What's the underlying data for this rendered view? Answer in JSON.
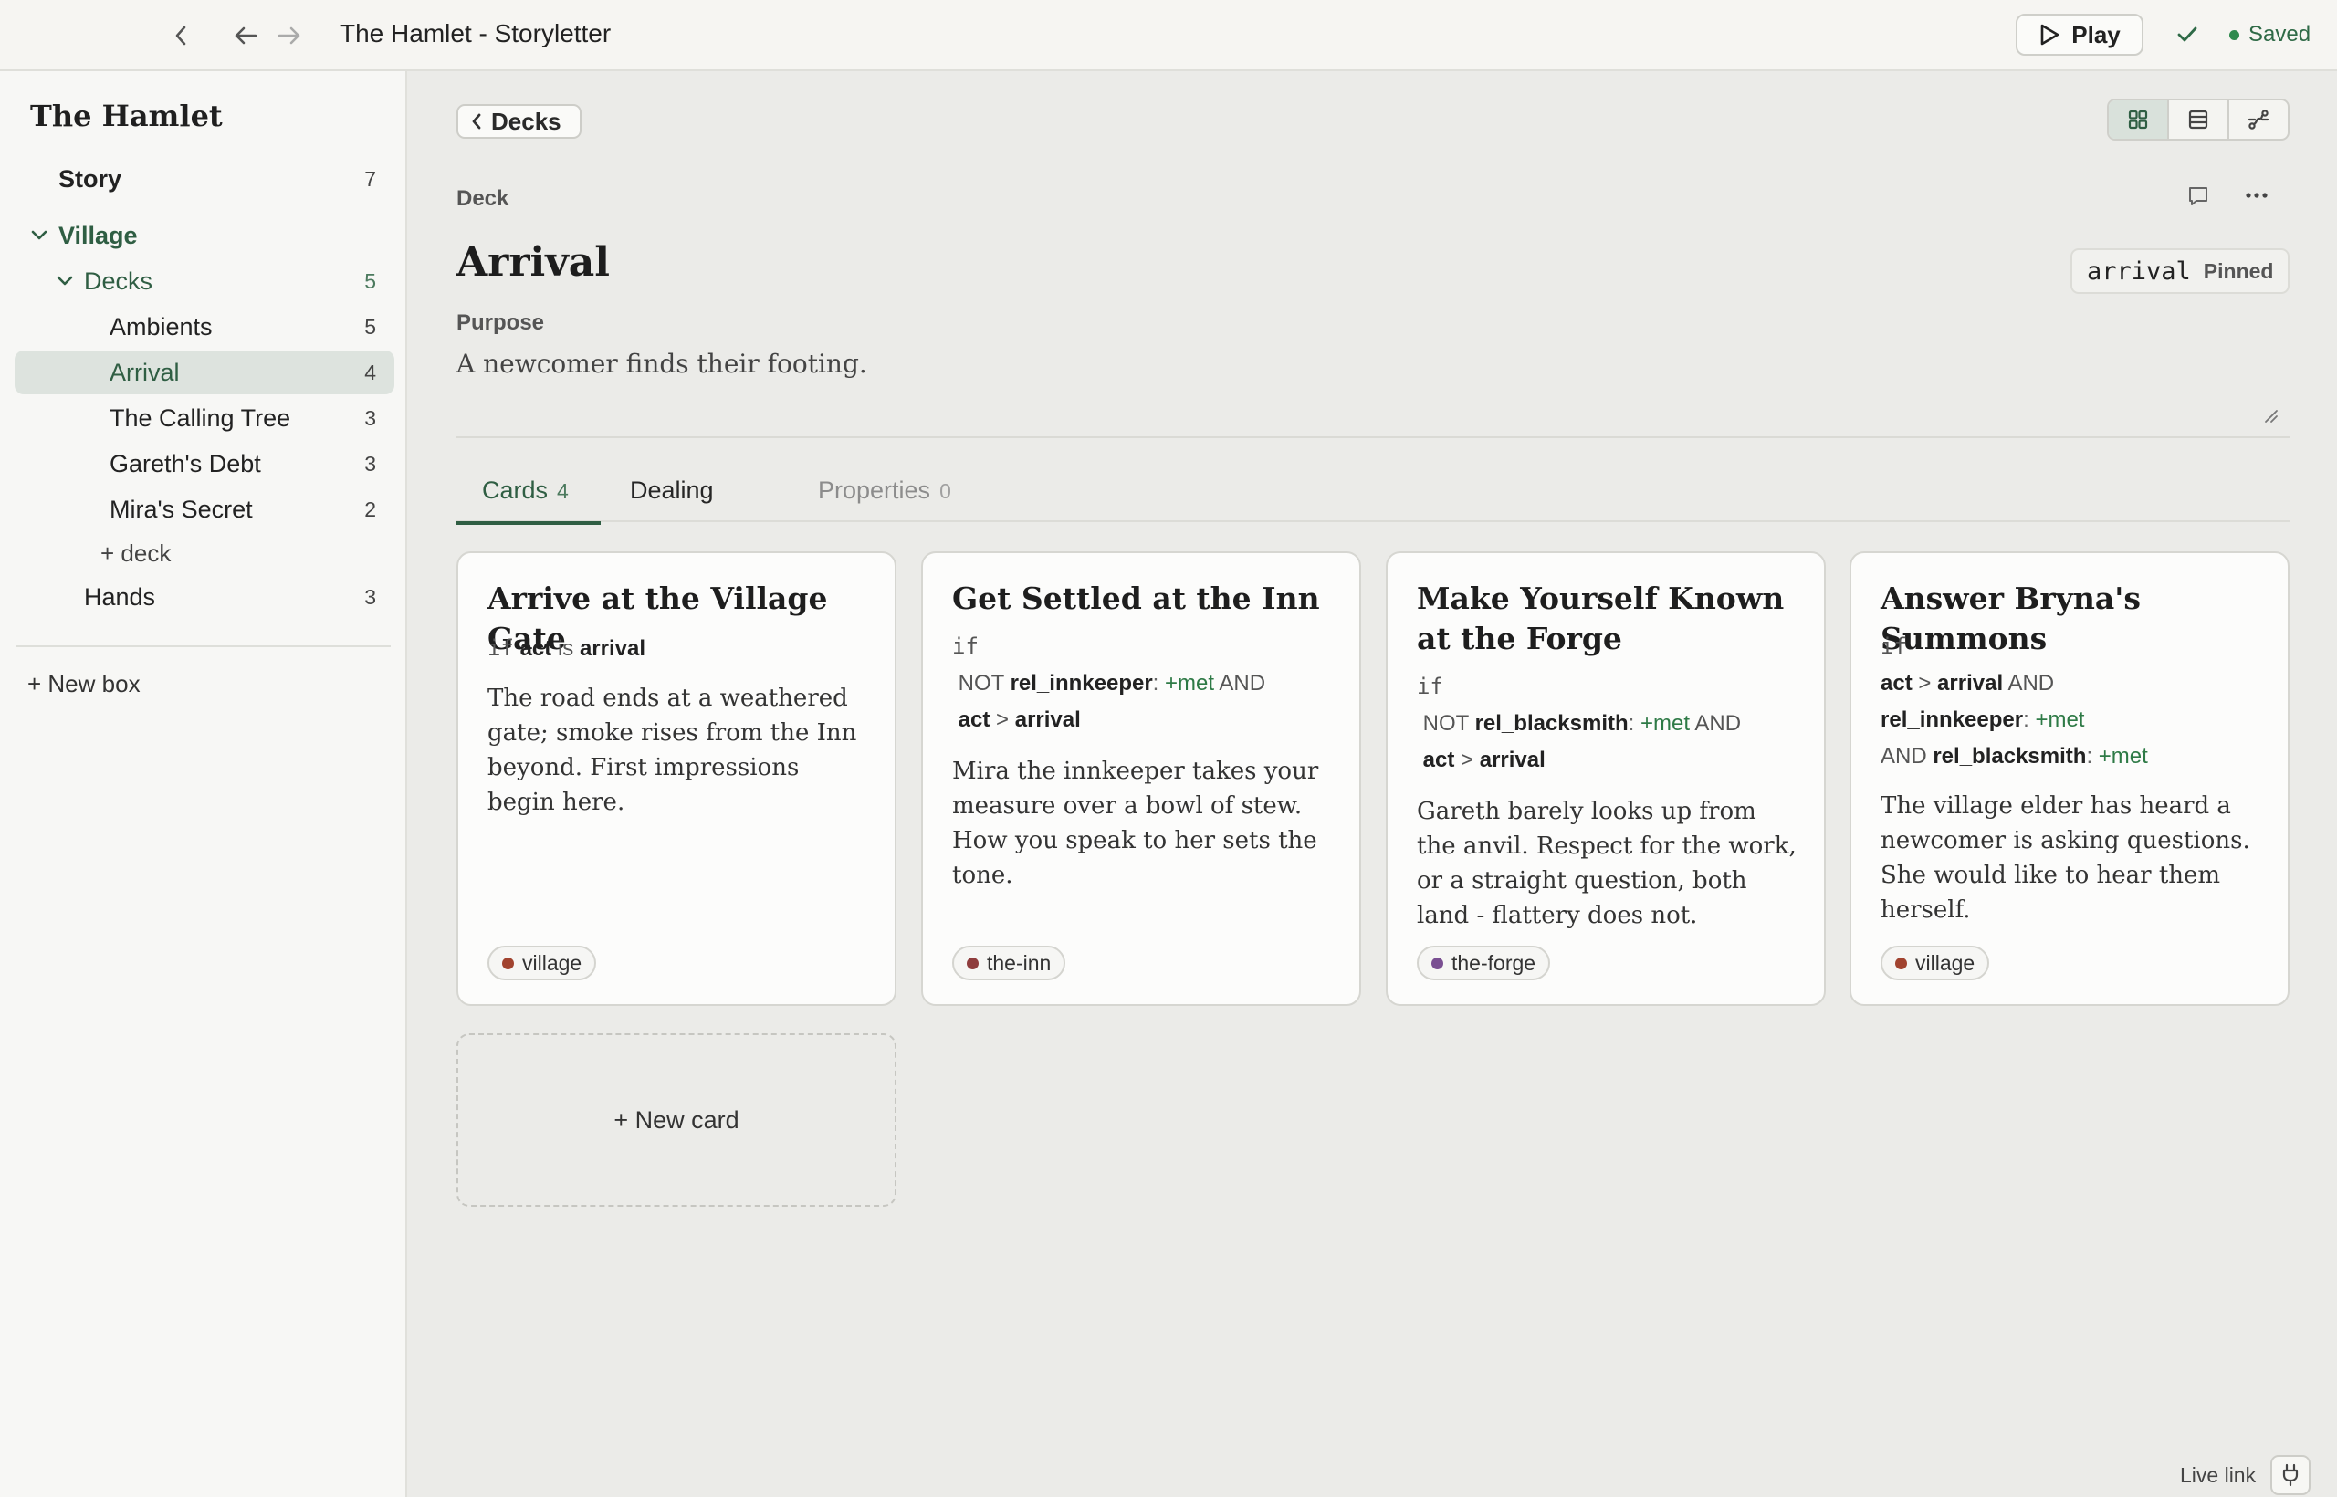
{
  "window": {
    "title": "The Hamlet - Storyletter",
    "play_label": "Play",
    "saved_label": "Saved",
    "icons": [
      "sidebar-collapse-icon",
      "back-arrow-icon",
      "forward-arrow-icon",
      "play-icon",
      "check-icon"
    ]
  },
  "sidebar": {
    "title": "The Hamlet",
    "story": {
      "label": "Story",
      "count": "7"
    },
    "village": {
      "label": "Village"
    },
    "decks": {
      "label": "Decks",
      "count": "5"
    },
    "deck_items": [
      {
        "label": "Ambients",
        "count": "5"
      },
      {
        "label": "Arrival",
        "count": "4"
      },
      {
        "label": "The Calling Tree",
        "count": "3"
      },
      {
        "label": "Gareth's Debt",
        "count": "3"
      },
      {
        "label": "Mira's Secret",
        "count": "2"
      }
    ],
    "add_deck": "+ deck",
    "hands": {
      "label": "Hands",
      "count": "3"
    },
    "new_box": "+ New box"
  },
  "main": {
    "back_label": "Decks",
    "view_modes": [
      "grid-view-icon",
      "list-view-icon",
      "graph-view-icon"
    ],
    "active_view": "grid",
    "kind_label": "Deck",
    "deck_title": "Arrival",
    "id_code": "arrival",
    "pinned_label": "Pinned",
    "purpose_label": "Purpose",
    "purpose_text": "A newcomer finds their footing.",
    "tabs": [
      {
        "label": "Cards",
        "count": "4"
      },
      {
        "label": "Dealing",
        "count": ""
      },
      {
        "label": "Properties",
        "count": "0"
      }
    ],
    "cards": [
      {
        "title": "Arrive at the Village Gate",
        "cond": {
          "if": "if",
          "var": "act",
          "op": "is",
          "val": "arrival"
        },
        "body": "The road ends at a weathered gate; smoke rises from the Inn beyond. First impressions begin here.",
        "tag": "village",
        "tag_color": "#a1432f"
      },
      {
        "title": "Get Settled at the Inn",
        "cond": {
          "if": "if",
          "not": "NOT",
          "rel": "rel_innkeeper",
          "colon": ":",
          "met": "+met",
          "and": "AND",
          "var": "act",
          "op": ">",
          "val": "arrival"
        },
        "body": "Mira the innkeeper takes your measure over a bowl of stew. How you speak to her sets the tone.",
        "tag": "the-inn",
        "tag_color": "#8f3d3d"
      },
      {
        "title": "Make Yourself Known at the Forge",
        "cond": {
          "if": "if",
          "not": "NOT",
          "rel": "rel_blacksmith",
          "colon": ":",
          "met": "+met",
          "and": "AND",
          "var": "act",
          "op": ">",
          "val": "arrival"
        },
        "body": "Gareth barely looks up from the anvil. Respect for the work, or a straight question, both land - flattery does not.",
        "tag": "the-forge",
        "tag_color": "#7a4f92"
      },
      {
        "title": "Answer Bryna's Summons",
        "cond": {
          "if": "if",
          "var": "act",
          "op": ">",
          "val": "arrival",
          "and": "AND",
          "rel1": "rel_innkeeper",
          "colon": ":",
          "met1": "+met",
          "and2": "AND",
          "rel2": "rel_blacksmith",
          "met2": "+met"
        },
        "body": "The village elder has heard a newcomer is asking questions. She would like to hear them herself.",
        "tag": "village",
        "tag_color": "#a1432f"
      }
    ],
    "new_card": "+ New card",
    "live_link": "Live link"
  },
  "colors": {
    "accent": "#2f5e43",
    "saved_dot": "#2f8a4e",
    "met": "#2e7a46"
  }
}
